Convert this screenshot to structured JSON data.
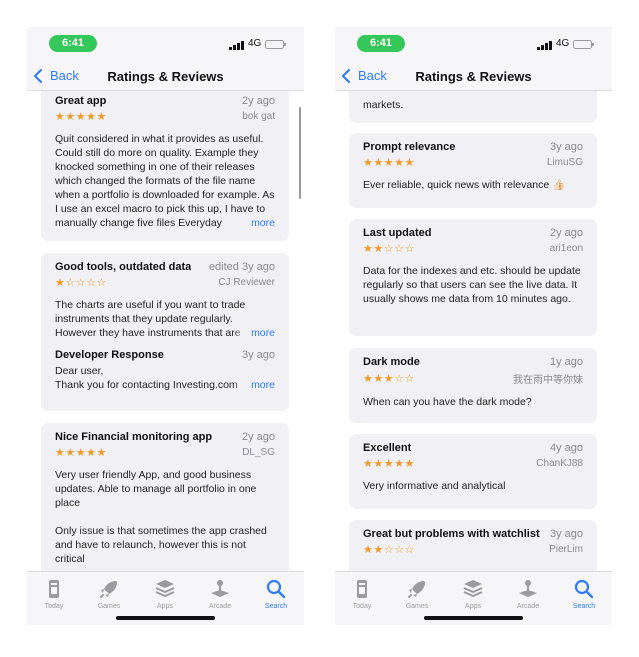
{
  "left": {
    "status": {
      "time": "6:41",
      "network": "4G"
    },
    "nav": {
      "back_label": "Back",
      "title": "Ratings & Reviews"
    },
    "reviews": [
      {
        "title": "Great app",
        "date": "2y ago",
        "stars": "★★★★★",
        "author": "bok gat",
        "body": "Quit considered in what it provides as useful. Could still do more on quality. Example they knocked something in one of their releases which changed the formats of the file name when a portfolio is downloaded for example. As I use an excel macro to pick this up, I have to manually change five files Everyday",
        "more": "more"
      },
      {
        "title": "Good tools, outdated data",
        "date": "edited 3y ago",
        "stars": "★☆☆☆☆",
        "author": "CJ Reviewer",
        "body": "The charts are useful if you want to trade instruments that they update regularly. However they have instruments that are",
        "more": "more",
        "developer_response": {
          "title": "Developer Response",
          "date": "3y ago",
          "body": "Dear user,\nThank you for contacting Investing.com",
          "more": "more"
        }
      },
      {
        "title": "Nice Financial monitoring app",
        "date": "2y ago",
        "stars": "★★★★★",
        "author": "DL_SG",
        "body": "Very user friendly App, and good business updates. Able to manage all portfolio in one place",
        "body2": "Only issue is that sometimes the app crashed and have to relaunch, however this is not critical"
      }
    ]
  },
  "right": {
    "status": {
      "time": "6:41",
      "network": "4G"
    },
    "nav": {
      "back_label": "Back",
      "title": "Ratings & Reviews"
    },
    "partial_text": "markets.",
    "reviews": [
      {
        "title": "Prompt relevance",
        "date": "3y ago",
        "stars": "★★★★★",
        "author": "LimuSG",
        "body": "Ever reliable, quick news with relevance 👍🏻"
      },
      {
        "title": "Last updated",
        "date": "2y ago",
        "stars": "★★☆☆☆",
        "author": "ari1eon",
        "body": "Data for the indexes and etc. should be update regularly so that users can see the live data. It usually shows me data from 10 minutes ago."
      },
      {
        "title": "Dark mode",
        "date": "1y ago",
        "stars": "★★★☆☆",
        "author": "我在雨中等你妹",
        "body": "When can you have the dark mode?"
      },
      {
        "title": "Excellent",
        "date": "4y ago",
        "stars": "★★★★★",
        "author": "ChanKJ88",
        "body": "Very informative and analytical"
      },
      {
        "title": "Great but problems with watchlist",
        "date": "3y ago",
        "stars": "★★☆☆☆",
        "author": "PierLim"
      }
    ]
  },
  "tabs": [
    {
      "label": "Today",
      "icon": "today-icon"
    },
    {
      "label": "Games",
      "icon": "games-rocket-icon"
    },
    {
      "label": "Apps",
      "icon": "apps-stack-icon"
    },
    {
      "label": "Arcade",
      "icon": "arcade-joystick-icon"
    },
    {
      "label": "Search",
      "icon": "search-icon",
      "active": true
    }
  ],
  "colors": {
    "accent": "#2f7cf6",
    "stars": "#f09a2c",
    "status_pill": "#34c759",
    "card": "#f1f1f5"
  }
}
